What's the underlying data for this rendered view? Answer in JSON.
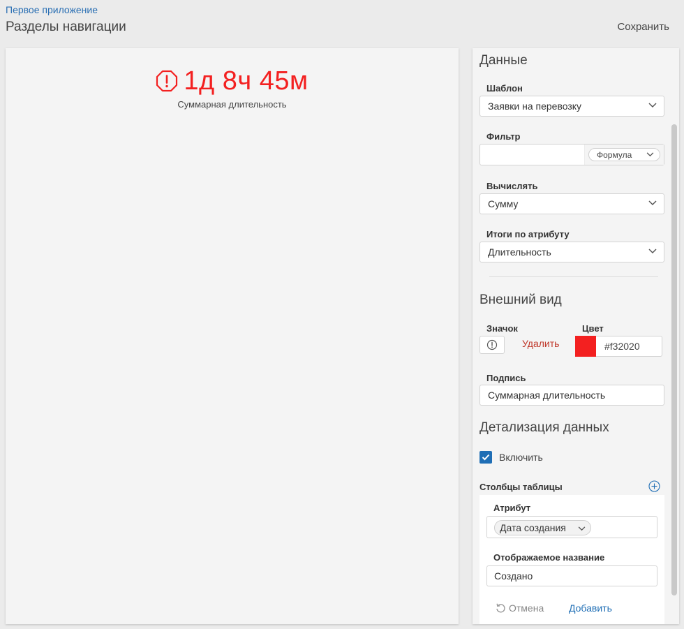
{
  "header": {
    "breadcrumb": "Первое приложение",
    "title": "Разделы навигации",
    "save_label": "Сохранить"
  },
  "preview": {
    "value": "1д 8ч 45м",
    "caption": "Суммарная длительность",
    "icon": "exclamation-octagon-icon",
    "color": "#f32020"
  },
  "data_section": {
    "title": "Данные",
    "template": {
      "label": "Шаблон",
      "value": "Заявки на перевозку"
    },
    "filter": {
      "label": "Фильтр",
      "value": "",
      "mode": "Формула"
    },
    "compute": {
      "label": "Вычислять",
      "value": "Сумму"
    },
    "group_by": {
      "label": "Итоги по атрибуту",
      "value": "Длительность"
    }
  },
  "appearance": {
    "title": "Внешний вид",
    "icon_label": "Значок",
    "icon": "exclamation-circle-icon",
    "delete_label": "Удалить",
    "color_label": "Цвет",
    "color_value": "#f32020",
    "caption_label": "Подпись",
    "caption_value": "Суммарная длительность"
  },
  "drilldown": {
    "title": "Детализация данных",
    "enable_label": "Включить",
    "enabled": true,
    "columns_label": "Столбцы таблицы",
    "column_form": {
      "attribute_label": "Атрибут",
      "attribute_value": "Дата создания",
      "display_name_label": "Отображаемое название",
      "display_name_value": "Создано",
      "cancel_label": "Отмена",
      "add_label": "Добавить"
    }
  },
  "colors": {
    "accent": "#1f6eb5",
    "danger": "#f32020",
    "delete": "#c0392b"
  }
}
